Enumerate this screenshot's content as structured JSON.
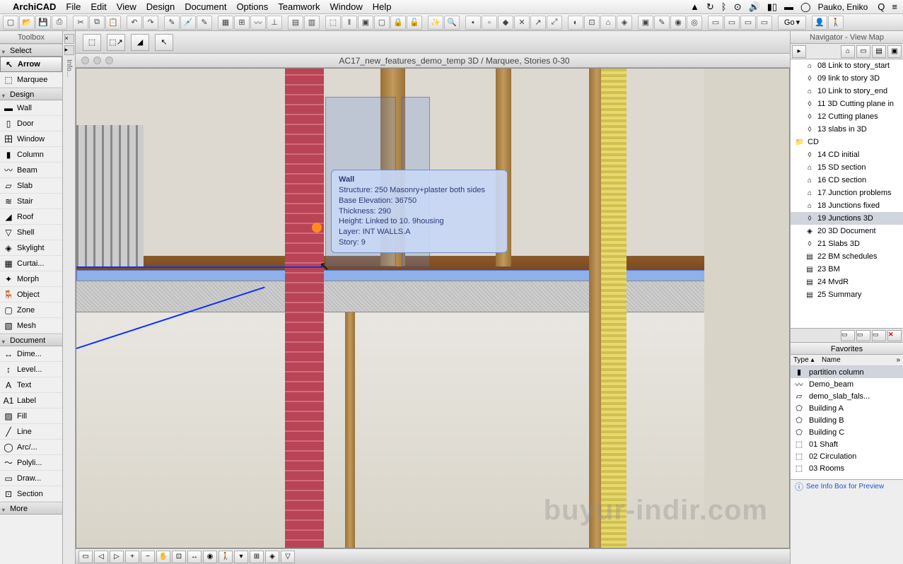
{
  "menubar": {
    "app_name": "ArchiCAD",
    "items": [
      "File",
      "Edit",
      "View",
      "Design",
      "Document",
      "Options",
      "Teamwork",
      "Window",
      "Help"
    ],
    "user_name": "Pauko, Eniko"
  },
  "toolbar_go": "Go",
  "toolbox": {
    "title": "Toolbox",
    "sections": {
      "select": {
        "label": "Select",
        "tools": [
          {
            "icon": "↖",
            "label": "Arrow",
            "selected": true
          },
          {
            "icon": "⬚",
            "label": "Marquee"
          }
        ]
      },
      "design": {
        "label": "Design",
        "tools": [
          {
            "icon": "▬",
            "label": "Wall"
          },
          {
            "icon": "▯",
            "label": "Door"
          },
          {
            "icon": "田",
            "label": "Window"
          },
          {
            "icon": "▮",
            "label": "Column"
          },
          {
            "icon": "〰",
            "label": "Beam"
          },
          {
            "icon": "▱",
            "label": "Slab"
          },
          {
            "icon": "≋",
            "label": "Stair"
          },
          {
            "icon": "◢",
            "label": "Roof"
          },
          {
            "icon": "▽",
            "label": "Shell"
          },
          {
            "icon": "◈",
            "label": "Skylight"
          },
          {
            "icon": "▦",
            "label": "Curtai..."
          },
          {
            "icon": "✦",
            "label": "Morph"
          },
          {
            "icon": "🪑",
            "label": "Object"
          },
          {
            "icon": "▢",
            "label": "Zone"
          },
          {
            "icon": "▧",
            "label": "Mesh"
          }
        ]
      },
      "document": {
        "label": "Document",
        "tools": [
          {
            "icon": "↔",
            "label": "Dime..."
          },
          {
            "icon": "↕",
            "label": "Level..."
          },
          {
            "icon": "A",
            "label": "Text"
          },
          {
            "icon": "A1",
            "label": "Label"
          },
          {
            "icon": "▨",
            "label": "Fill"
          },
          {
            "icon": "╱",
            "label": "Line"
          },
          {
            "icon": "◯",
            "label": "Arc/..."
          },
          {
            "icon": "〜",
            "label": "Polyli..."
          },
          {
            "icon": "▭",
            "label": "Draw..."
          },
          {
            "icon": "⊡",
            "label": "Section"
          }
        ]
      },
      "more": {
        "label": "More"
      }
    }
  },
  "info_label": "Info...",
  "window_title": "AC17_new_features_demo_temp 3D / Marquee, Stories 0-30",
  "tooltip": {
    "title": "Wall",
    "lines": [
      "Structure: 250 Masonry+plaster both sides",
      "Base Elevation: 36750",
      "Thickness: 290",
      "Height: Linked to 10. 9housing",
      "Layer: INT WALLS.A",
      "Story: 9"
    ]
  },
  "watermark": "buyur-indir.com",
  "navigator": {
    "title": "Navigator - View Map",
    "items": [
      {
        "icon": "⌂",
        "label": "08 Link to story_start",
        "indent": true
      },
      {
        "icon": "◊",
        "label": "09 link to story 3D",
        "indent": true
      },
      {
        "icon": "⌂",
        "label": "10 Link to story_end",
        "indent": true
      },
      {
        "icon": "◊",
        "label": "11 3D Cutting plane in",
        "indent": true
      },
      {
        "icon": "◊",
        "label": "12 Cutting planes",
        "indent": true
      },
      {
        "icon": "◊",
        "label": "13 slabs in 3D",
        "indent": true
      },
      {
        "icon": "📁",
        "label": "CD",
        "indent": false
      },
      {
        "icon": "◊",
        "label": "14 CD initial",
        "indent": true
      },
      {
        "icon": "⌂",
        "label": "15 SD section",
        "indent": true
      },
      {
        "icon": "⌂",
        "label": "16 CD section",
        "indent": true
      },
      {
        "icon": "⌂",
        "label": "17 Junction problems",
        "indent": true
      },
      {
        "icon": "⌂",
        "label": "18 Junctions fixed",
        "indent": true
      },
      {
        "icon": "◊",
        "label": "19 Junctions 3D",
        "indent": true,
        "selected": true
      },
      {
        "icon": "◈",
        "label": "20 3D Document",
        "indent": true
      },
      {
        "icon": "◊",
        "label": "21 Slabs 3D",
        "indent": true
      },
      {
        "icon": "▤",
        "label": "22 BM schedules",
        "indent": true
      },
      {
        "icon": "▤",
        "label": "23 BM",
        "indent": true
      },
      {
        "icon": "▤",
        "label": "24 MvdR",
        "indent": true
      },
      {
        "icon": "▤",
        "label": "25 Summary",
        "indent": true
      }
    ]
  },
  "favorites": {
    "title": "Favorites",
    "cols": {
      "type": "Type",
      "name": "Name"
    },
    "items": [
      {
        "icon": "▮",
        "label": "partition column",
        "selected": true
      },
      {
        "icon": "〰",
        "label": "Demo_beam"
      },
      {
        "icon": "▱",
        "label": "demo_slab_fals..."
      },
      {
        "icon": "⬠",
        "label": "Building A"
      },
      {
        "icon": "⬠",
        "label": "Building B"
      },
      {
        "icon": "⬠",
        "label": "Building C"
      },
      {
        "icon": "⬚",
        "label": "01 Shaft"
      },
      {
        "icon": "⬚",
        "label": "02 Circulation"
      },
      {
        "icon": "⬚",
        "label": "03 Rooms"
      }
    ]
  },
  "preview_hint": "See Info Box for Preview"
}
